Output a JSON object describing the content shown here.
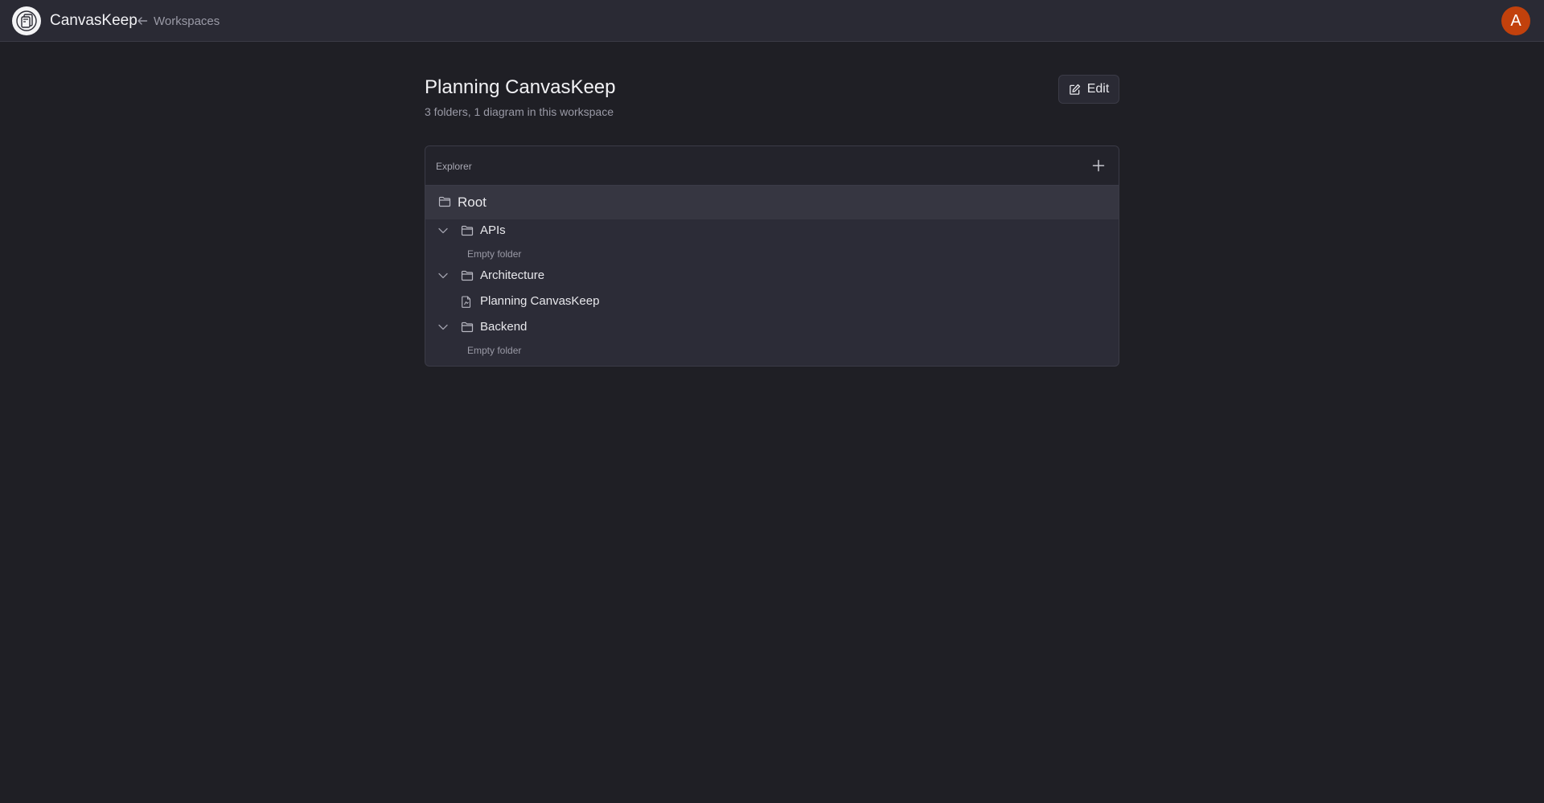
{
  "app": {
    "brand": "CanvasKeep",
    "back_label": "Workspaces",
    "avatar_initial": "A"
  },
  "header": {
    "title": "Planning CanvasKeep",
    "subtitle": "3 folders, 1 diagram in this workspace",
    "edit_label": "Edit"
  },
  "explorer": {
    "label": "Explorer",
    "root": {
      "label": "Root"
    },
    "folders": [
      {
        "label": "APIs",
        "expanded": true,
        "empty_text": "Empty folder"
      },
      {
        "label": "Architecture",
        "expanded": true,
        "children": [
          {
            "label": "Planning CanvasKeep",
            "type": "diagram"
          }
        ]
      },
      {
        "label": "Backend",
        "expanded": true,
        "empty_text": "Empty folder"
      }
    ]
  },
  "colors": {
    "background": "#1f1f25",
    "topbar": "#2a2a34",
    "panel": "#2c2c37",
    "avatar": "#c2410c"
  },
  "icons": {
    "logo": "canvaskeep-logo-icon",
    "back": "arrow-left-icon",
    "edit": "pencil-square-icon",
    "add": "plus-icon",
    "folder": "folder-icon",
    "chevron": "chevron-down-icon",
    "file": "file-diagram-icon"
  }
}
